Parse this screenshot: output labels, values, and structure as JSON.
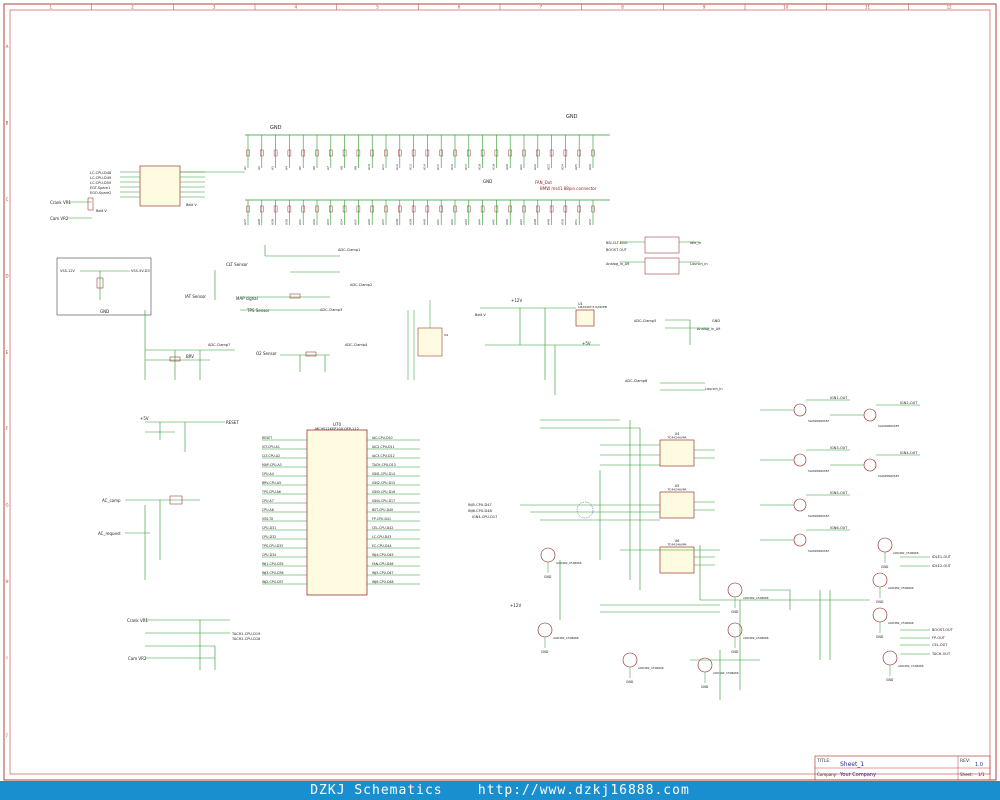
{
  "page": {
    "watermark": "DZKJ Schematics    http://www.dzkj16888.com"
  },
  "frame": {
    "cols": [
      "1",
      "2",
      "3",
      "4",
      "5",
      "6",
      "7",
      "8",
      "9",
      "10",
      "11",
      "12"
    ],
    "rows": [
      "A",
      "B",
      "C",
      "D",
      "E",
      "F",
      "G",
      "H",
      "I",
      "J"
    ]
  },
  "title_block": {
    "title_label": "TITLE:",
    "title": "Sheet_1",
    "rev_label": "REV:",
    "rev": "1.0",
    "company_label": "Company:",
    "company": "Your Company",
    "sheet_label": "Sheet:",
    "sheet": "1/1"
  },
  "power": {
    "gnd": "GND",
    "vcc": "+5V",
    "v12": "+12V"
  },
  "connector_pins": [
    "A1",
    "A2",
    "A3",
    "A4",
    "A5",
    "A6",
    "A7",
    "A8",
    "A9",
    "A10",
    "A11",
    "A12",
    "A13",
    "A14",
    "A15",
    "A16",
    "A17",
    "A18",
    "A19",
    "A20",
    "A21",
    "A22",
    "A23",
    "A24",
    "A25",
    "A26",
    "A27",
    "A28",
    "A29",
    "A30",
    "A31",
    "A32",
    "A33",
    "A34",
    "A35",
    "A36",
    "A37",
    "A38",
    "A39",
    "A40",
    "A41",
    "A42",
    "A43",
    "A44",
    "A45",
    "A46",
    "A47",
    "A48",
    "A49",
    "A50",
    "A51",
    "A52"
  ],
  "connector": {
    "ref": "X1",
    "desc": "BMW ms41 88pin connector"
  },
  "mcu": {
    "ref": "U70",
    "part": "MC9S12XEP100 QFP-112",
    "left_pins": [
      "RESET",
      "IGT-CPU-A1",
      "CLT-CPU-A2",
      "MAP-CPU-A3",
      "CPU-A4",
      "BRV-CPU-A5",
      "TPS-CPU-A6",
      "CPU-A7",
      "CPU-A8",
      "VSS-TX",
      "CPU-D31",
      "CPU-D32",
      "TPS-CPU-D33",
      "CPU-D34",
      "INJ1-CPU-D35",
      "INJ3-CPU-D36",
      "INJ2-CPU-D37"
    ],
    "right_pins": [
      "IAC-CPU-D10",
      "IAC2-CPU-D11",
      "IAC3-CPU-D12",
      "TACH-CPU-D13",
      "IGN1-CPU-D14",
      "IGN2-CPU-D15",
      "IGN3-CPU-D16",
      "IGN4-CPU-D17",
      "BST-CPU-D40",
      "FP-CPU-D41",
      "CEL-CPU-D42",
      "LC-CPU-D43",
      "EC-CPU-D44",
      "INJ4-CPU-D45",
      "FAN-CPU-D46",
      "INJ5-CPU-D47",
      "INJ6-CPU-D48"
    ]
  },
  "sensors": {
    "crank_vr": "Crank VR1",
    "cam_vr": "Cam VR2",
    "clt": "CLT Sensor",
    "iat": "IAT Sensor",
    "map": "MAP signal",
    "tps": "TPS Sensor",
    "o2": "O2 Sensor",
    "brv": "BRV",
    "batt": "Batt V",
    "vss": "VSS-12V",
    "vss_out": "VSS-5V-D3"
  },
  "clamps": [
    "ADC-Clamp1",
    "ADC-Clamp2",
    "ADC-Clamp3",
    "ADC-Clamp4",
    "ADC-Clamp5",
    "ADC-Clamp6",
    "ADC-Clamp7"
  ],
  "reg": {
    "ref": "U1",
    "part": "LM2940T-5.0/NOPB",
    "in": "+12V",
    "out": "+5V",
    "batt": "Batt V"
  },
  "drivers": [
    {
      "ref": "U4",
      "part": "TC4424AVPA"
    },
    {
      "ref": "U5",
      "part": "TC4424AVPA"
    },
    {
      "ref": "U6",
      "part": "TC4424AVPA"
    }
  ],
  "igbts": [
    "IGN1-OUT",
    "IGN2-OUT",
    "IGN3-OUT",
    "IGN4-OUT",
    "IGN5-OUT",
    "IGN6-OUT"
  ],
  "fet_outputs": [
    "IDLE1-OUT",
    "IDLE2-OUT",
    "BOOST-OUT",
    "FP-OUT",
    "CEL-OUT",
    "TACH-OUT"
  ],
  "fet_part": "AOD482_C506666",
  "igbt_part": "SGW20N60S87",
  "misc": {
    "launch": "Launch_in",
    "analog": "Analog_in_A9",
    "ac_req": "AC_request",
    "ac_comp": "AC_comp",
    "fan_out": "FAN_Out",
    "boost": "BOOST OUT",
    "idle_valve": "Idle valve",
    "main_relay": "Main relay",
    "knock": "Knock"
  }
}
